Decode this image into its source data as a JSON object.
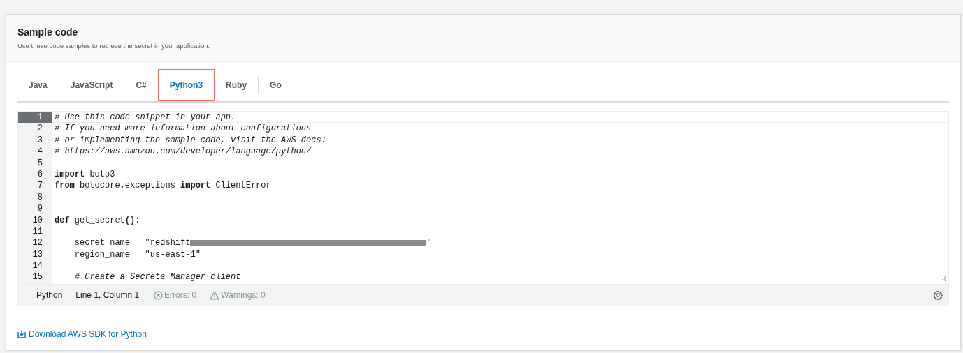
{
  "header": {
    "title": "Sample code",
    "description": "Use these code samples to retrieve the secret in your application."
  },
  "tabs": [
    {
      "label": "Java",
      "selected": false
    },
    {
      "label": "JavaScript",
      "selected": false
    },
    {
      "label": "C#",
      "selected": false
    },
    {
      "label": "Python3",
      "selected": true
    },
    {
      "label": "Ruby",
      "selected": false
    },
    {
      "label": "Go",
      "selected": false
    }
  ],
  "editor": {
    "lines": [
      {
        "number": "1",
        "current": true,
        "tokens": [
          {
            "kind": "comment",
            "text": "# Use this code snippet in your app."
          }
        ]
      },
      {
        "number": "2",
        "current": false,
        "tokens": [
          {
            "kind": "comment",
            "text": "# If you need more information about configurations"
          }
        ]
      },
      {
        "number": "3",
        "current": false,
        "tokens": [
          {
            "kind": "comment",
            "text": "# or implementing the sample code, visit the AWS docs:"
          }
        ]
      },
      {
        "number": "4",
        "current": false,
        "tokens": [
          {
            "kind": "comment",
            "text": "# https://aws.amazon.com/developer/language/python/"
          }
        ]
      },
      {
        "number": "5",
        "current": false
      },
      {
        "number": "6",
        "current": false,
        "tokens": [
          {
            "kind": "keyword",
            "text": "import"
          },
          {
            "kind": "plain",
            "text": " boto3"
          }
        ]
      },
      {
        "number": "7",
        "current": false,
        "tokens": [
          {
            "kind": "keyword",
            "text": "from"
          },
          {
            "kind": "plain",
            "text": " botocore.exceptions "
          },
          {
            "kind": "keyword",
            "text": "import"
          },
          {
            "kind": "plain",
            "text": " ClientError"
          }
        ]
      },
      {
        "number": "8",
        "current": false
      },
      {
        "number": "9",
        "current": false
      },
      {
        "number": "10",
        "current": false,
        "tokens": [
          {
            "kind": "keyword",
            "text": "def"
          },
          {
            "kind": "plain",
            "text": " get_secret"
          },
          {
            "kind": "keyword",
            "text": "()"
          },
          {
            "kind": "plain",
            "text": ":"
          }
        ]
      },
      {
        "number": "11",
        "current": false
      },
      {
        "number": "12",
        "current": false,
        "tokens": [
          {
            "kind": "plain",
            "text": "    secret_name = \"redshift"
          },
          {
            "kind": "redacted"
          },
          {
            "kind": "plain",
            "text": "\""
          }
        ]
      },
      {
        "number": "13",
        "current": false,
        "tokens": [
          {
            "kind": "plain",
            "text": "    region_name = \"us-east-1\""
          }
        ]
      },
      {
        "number": "14",
        "current": false
      },
      {
        "number": "15",
        "current": false,
        "tokens": [
          {
            "kind": "comment",
            "text": "    # Create a Secrets Manager client"
          }
        ]
      }
    ]
  },
  "status_bar": {
    "language": "Python",
    "position": "Line 1, Column 1",
    "errors": "Errors: 0",
    "warnings": "Warnings: 0"
  },
  "download_link": "Download AWS SDK for Python"
}
